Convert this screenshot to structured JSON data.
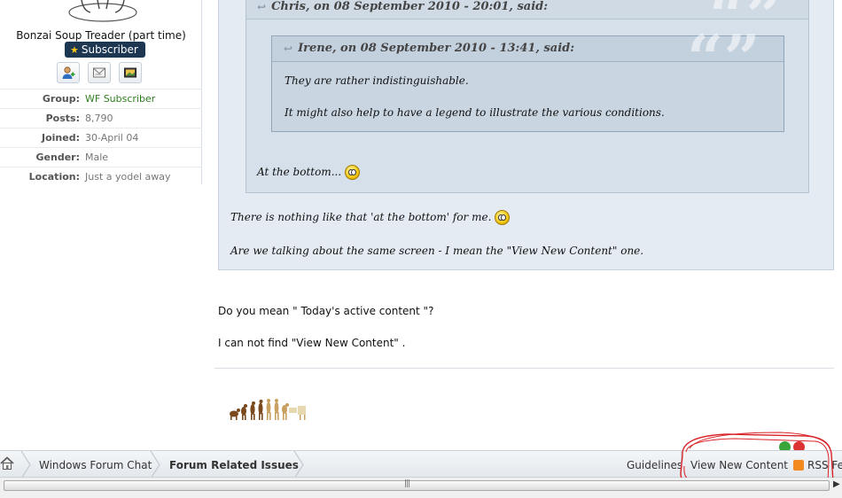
{
  "author": {
    "title": "Bonzai Soup Treader (part time)",
    "badge": "Subscriber",
    "icons": [
      "add-friend-icon",
      "send-message-icon",
      "view-gallery-icon"
    ],
    "stats": [
      {
        "label": "Group:",
        "value": "WF Subscriber"
      },
      {
        "label": "Posts:",
        "value": "8,790"
      },
      {
        "label": "Joined:",
        "value": "30-April 04"
      },
      {
        "label": "Gender:",
        "value": "Male"
      },
      {
        "label": "Location:",
        "value": "Just a yodel away"
      }
    ]
  },
  "quotes": {
    "outer_head": "Chris, on 08 September 2010 - 20:01, said:",
    "inner_head": "Irene, on 08 September 2010 - 13:41, said:",
    "inner_line1": "They are rather indistinguishable.",
    "inner_line2": "It might also help to have a legend to illustrate the various conditions.",
    "mid_line": "At the bottom...",
    "outer_line1": "There is nothing like that 'at the bottom' for me.",
    "outer_line2": "Are we talking about the same screen - I mean the \"View New Content\" one."
  },
  "post": {
    "line1": "Do you mean \" Today's active content \"?",
    "line2": "I can not find \"View New Content\" ."
  },
  "breadcrumb": {
    "items": [
      "Windows Forum Chat",
      "Forum Related Issues"
    ],
    "links": {
      "guidelines": "Guidelines",
      "view_new": "View New Content",
      "rss": "RSS Feed"
    }
  },
  "colors": {
    "accent": "#1d3652",
    "group_green": "#2e7d1e",
    "annotation": "#d9252a"
  }
}
